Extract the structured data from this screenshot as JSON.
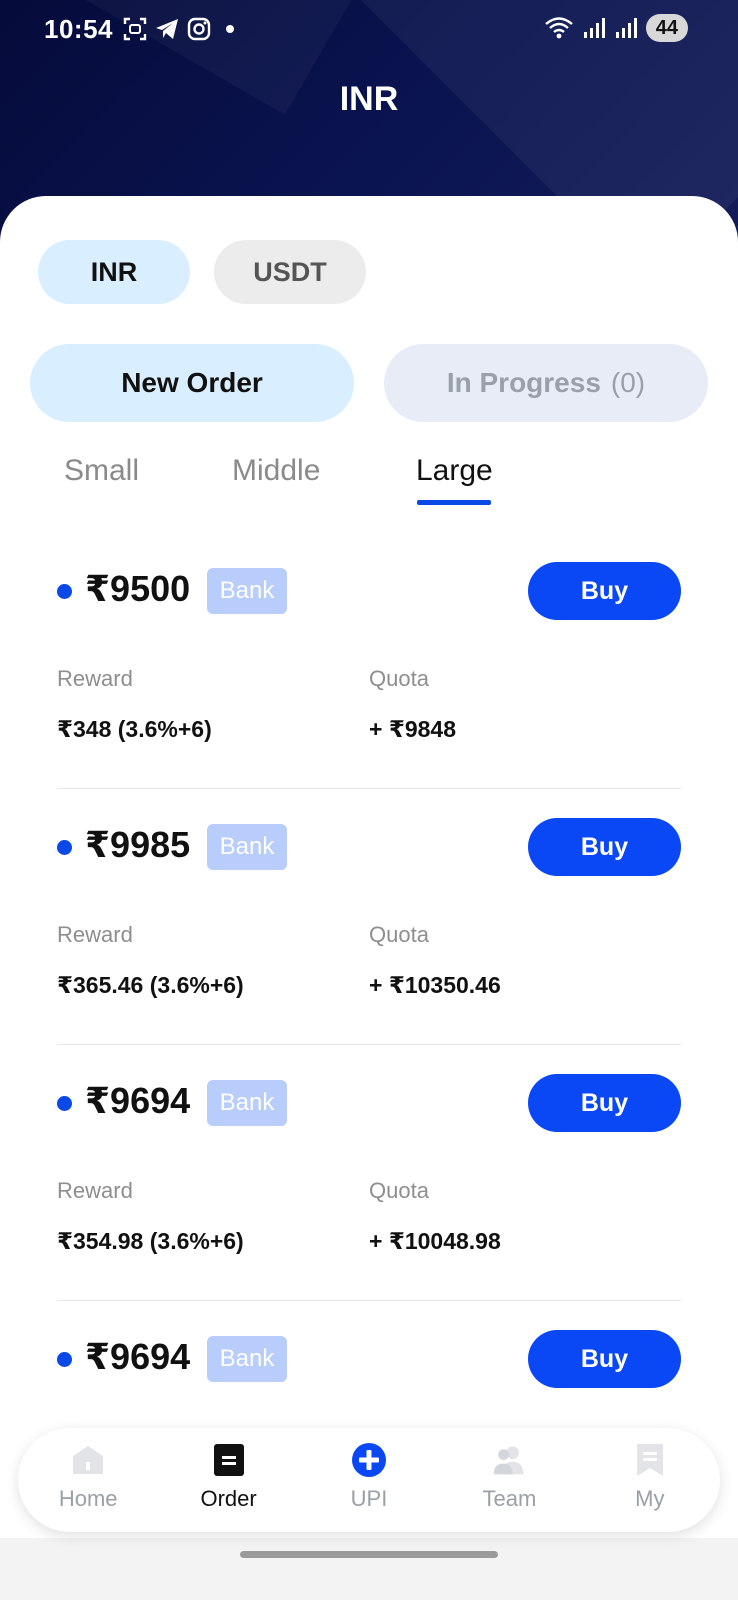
{
  "status_bar": {
    "time": "10:54",
    "battery": "44",
    "icons": [
      "screenshot-icon",
      "telegram-icon",
      "instagram-icon",
      "dot-icon",
      "wifi-icon",
      "signal-icon",
      "signal-icon"
    ]
  },
  "header": {
    "title": "INR"
  },
  "currency_tabs": [
    {
      "label": "INR",
      "active": true
    },
    {
      "label": "USDT",
      "active": false
    }
  ],
  "order_tabs": {
    "new_order": "New Order",
    "in_progress": "In Progress",
    "in_progress_count": "(0)"
  },
  "size_tabs": [
    {
      "label": "Small",
      "active": false
    },
    {
      "label": "Middle",
      "active": false
    },
    {
      "label": "Large",
      "active": true
    }
  ],
  "orders": [
    {
      "amount": "₹9500",
      "method": "Bank",
      "buy": "Buy",
      "reward_label": "Reward",
      "reward": "₹348 (3.6%+6)",
      "quota_label": "Quota",
      "quota": "+ ₹9848"
    },
    {
      "amount": "₹9985",
      "method": "Bank",
      "buy": "Buy",
      "reward_label": "Reward",
      "reward": "₹365.46 (3.6%+6)",
      "quota_label": "Quota",
      "quota": "+ ₹10350.46"
    },
    {
      "amount": "₹9694",
      "method": "Bank",
      "buy": "Buy",
      "reward_label": "Reward",
      "reward": "₹354.98 (3.6%+6)",
      "quota_label": "Quota",
      "quota": "+ ₹10048.98"
    },
    {
      "amount": "₹9694",
      "method": "Bank",
      "buy": "Buy"
    }
  ],
  "bottom_nav": [
    {
      "label": "Home",
      "icon": "home-icon",
      "active": false
    },
    {
      "label": "Order",
      "icon": "order-icon",
      "active": true
    },
    {
      "label": "UPI",
      "icon": "plus-circle-icon",
      "active": false
    },
    {
      "label": "Team",
      "icon": "team-icon",
      "active": false
    },
    {
      "label": "My",
      "icon": "bookmark-icon",
      "active": false
    }
  ],
  "colors": {
    "accent": "#0a48f5",
    "header_bg": "#050b3a",
    "active_pill": "#d9efff",
    "badge": "#b8cdfb"
  }
}
